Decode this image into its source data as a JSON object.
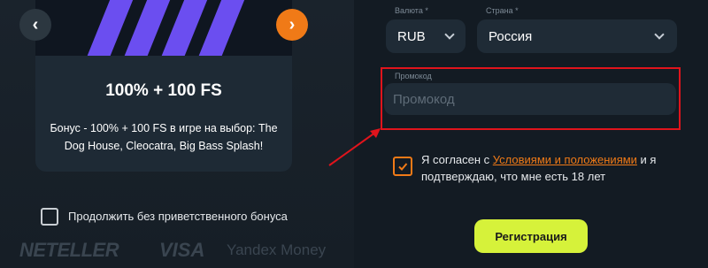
{
  "promo_card": {
    "title": "100% + 100 FS",
    "description": "Бонус - 100% + 100 FS в игре на выбор: The Dog House, Cleocatra, Big Bass Splash!",
    "prev_icon": "‹",
    "next_icon": "›"
  },
  "no_bonus": {
    "label": "Продолжить без приветственного бонуса"
  },
  "payments": [
    "NETELLER",
    "VISA",
    "Yandex Money"
  ],
  "form": {
    "currency": {
      "label": "Валюта *",
      "value": "RUB"
    },
    "country": {
      "label": "Страна *",
      "value": "Россия"
    },
    "promo": {
      "label": "Промокод",
      "placeholder": "Промокод"
    },
    "terms": {
      "prefix": "Я согласен с ",
      "link": "Условиями и положениями",
      "suffix": " и я подтверждаю, что мне есть 18 лет",
      "checked": true
    },
    "register_label": "Регистрация"
  },
  "colors": {
    "accent_orange": "#f07a17",
    "accent_lime": "#d6f23a",
    "highlight_red": "#e0141c",
    "banner_stripe": "#6b4ef0"
  }
}
